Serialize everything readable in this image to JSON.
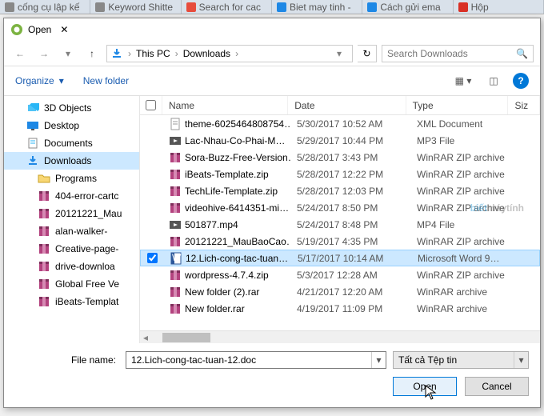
{
  "browser_tabs": [
    {
      "label": "cống cụ lập kế",
      "icon_color": "#888"
    },
    {
      "label": "Keyword Shitte",
      "icon_color": "#888"
    },
    {
      "label": "Search for cac",
      "icon_color": "#e74c3c"
    },
    {
      "label": "Biet may tinh -",
      "icon_color": "#1e88e5"
    },
    {
      "label": "Cách gửi ema",
      "icon_color": "#1e88e5"
    },
    {
      "label": "Hộp",
      "icon_color": "#d93025"
    }
  ],
  "dialog": {
    "title": "Open",
    "close_symbol": "✕"
  },
  "nav": {
    "path_parts": [
      "This PC",
      "Downloads"
    ],
    "search_placeholder": "Search Downloads"
  },
  "toolbar": {
    "organize": "Organize",
    "new_folder": "New folder"
  },
  "sidebar": {
    "items": [
      {
        "label": "3D Objects",
        "type": "3d",
        "nested": false,
        "selected": false
      },
      {
        "label": "Desktop",
        "type": "desktop",
        "nested": false,
        "selected": false
      },
      {
        "label": "Documents",
        "type": "documents",
        "nested": false,
        "selected": false
      },
      {
        "label": "Downloads",
        "type": "downloads",
        "nested": false,
        "selected": true
      },
      {
        "label": "Programs",
        "type": "folder",
        "nested": true,
        "selected": false
      },
      {
        "label": "404-error-cartc",
        "type": "winrar",
        "nested": true,
        "selected": false
      },
      {
        "label": "20121221_Mau",
        "type": "winrar",
        "nested": true,
        "selected": false
      },
      {
        "label": "alan-walker-",
        "type": "winrar",
        "nested": true,
        "selected": false
      },
      {
        "label": "Creative-page-",
        "type": "winrar",
        "nested": true,
        "selected": false
      },
      {
        "label": "drive-downloa",
        "type": "winrar",
        "nested": true,
        "selected": false
      },
      {
        "label": "Global Free Ve",
        "type": "winrar",
        "nested": true,
        "selected": false
      },
      {
        "label": "iBeats-Templat",
        "type": "winrar",
        "nested": true,
        "selected": false
      }
    ]
  },
  "filelist": {
    "headers": {
      "name": "Name",
      "date": "Date",
      "type": "Type",
      "size": "Siz"
    },
    "rows": [
      {
        "name": "theme-6025464808754…",
        "date": "5/30/2017 10:52 AM",
        "type": "XML Document",
        "icon": "text",
        "selected": false
      },
      {
        "name": "Lac-Nhau-Co-Phai-M…",
        "date": "5/29/2017 10:44 PM",
        "type": "MP3 File",
        "icon": "video",
        "selected": false
      },
      {
        "name": "Sora-Buzz-Free-Version…",
        "date": "5/28/2017 3:43 PM",
        "type": "WinRAR ZIP archive",
        "icon": "winrar",
        "selected": false
      },
      {
        "name": "iBeats-Template.zip",
        "date": "5/28/2017 12:22 PM",
        "type": "WinRAR ZIP archive",
        "icon": "winrar",
        "selected": false
      },
      {
        "name": "TechLife-Template.zip",
        "date": "5/28/2017 12:03 PM",
        "type": "WinRAR ZIP archive",
        "icon": "winrar",
        "selected": false
      },
      {
        "name": "videohive-6414351-mi…",
        "date": "5/24/2017 8:50 PM",
        "type": "WinRAR ZIP archive",
        "icon": "winrar",
        "selected": false
      },
      {
        "name": "501877.mp4",
        "date": "5/24/2017 8:48 PM",
        "type": "MP4 File",
        "icon": "video",
        "selected": false
      },
      {
        "name": "20121221_MauBaoCao…",
        "date": "5/19/2017 4:35 PM",
        "type": "WinRAR ZIP archive",
        "icon": "winrar",
        "selected": false
      },
      {
        "name": "12.Lich-cong-tac-tuan…",
        "date": "5/17/2017 10:14 AM",
        "type": "Microsoft Word 9…",
        "icon": "doc",
        "selected": true
      },
      {
        "name": "wordpress-4.7.4.zip",
        "date": "5/3/2017 12:28 AM",
        "type": "WinRAR ZIP archive",
        "icon": "winrar",
        "selected": false
      },
      {
        "name": "New folder (2).rar",
        "date": "4/21/2017 12:20 AM",
        "type": "WinRAR archive",
        "icon": "winrar",
        "selected": false
      },
      {
        "name": "New folder.rar",
        "date": "4/19/2017 11:09 PM",
        "type": "WinRAR archive",
        "icon": "winrar",
        "selected": false
      }
    ]
  },
  "footer": {
    "filename_label": "File name:",
    "filename_value": "12.Lich-cong-tac-tuan-12.doc",
    "filter_value": "Tất cả Tệp tin",
    "open": "Open",
    "cancel": "Cancel"
  },
  "watermark": {
    "prefix": "biết",
    "suffix": "máytính"
  }
}
